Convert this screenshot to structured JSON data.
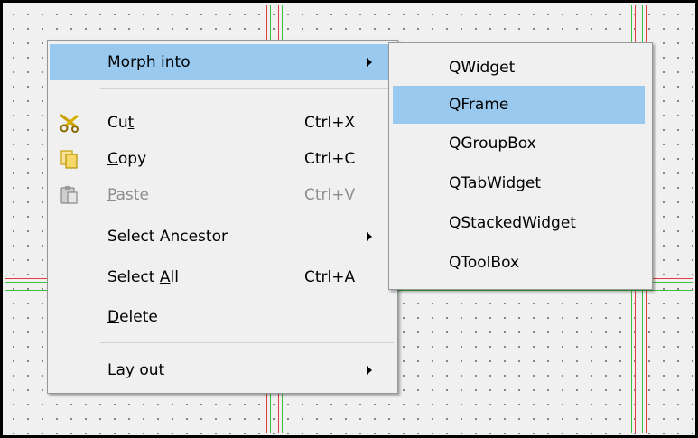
{
  "main_menu": {
    "items": [
      {
        "label": "Morph into",
        "has_submenu": true,
        "highlighted": true
      },
      {
        "label_pre": "Cu",
        "label_ul": "t",
        "label_post": "",
        "shortcut": "Ctrl+X",
        "icon": "scissors-icon"
      },
      {
        "label_pre": "",
        "label_ul": "C",
        "label_post": "opy",
        "shortcut": "Ctrl+C",
        "icon": "copy-icon"
      },
      {
        "label_pre": "",
        "label_ul": "P",
        "label_post": "aste",
        "shortcut": "Ctrl+V",
        "icon": "paste-icon",
        "disabled": true
      },
      {
        "label": "Select Ancestor",
        "has_submenu": true
      },
      {
        "label_pre": "Select ",
        "label_ul": "A",
        "label_post": "ll",
        "shortcut": "Ctrl+A"
      },
      {
        "label_pre": "",
        "label_ul": "D",
        "label_post": "elete"
      },
      {
        "label": "Lay out",
        "has_submenu": true
      }
    ]
  },
  "submenu": {
    "items": [
      "QWidget",
      "QFrame",
      "QGroupBox",
      "QTabWidget",
      "QStackedWidget",
      "QToolBox"
    ],
    "highlighted_index": 1
  },
  "colors": {
    "highlight": "#99c9ef",
    "guide_red": "#e04040",
    "guide_green": "#3fbf3f",
    "disabled_text": "#8d8d8d"
  }
}
